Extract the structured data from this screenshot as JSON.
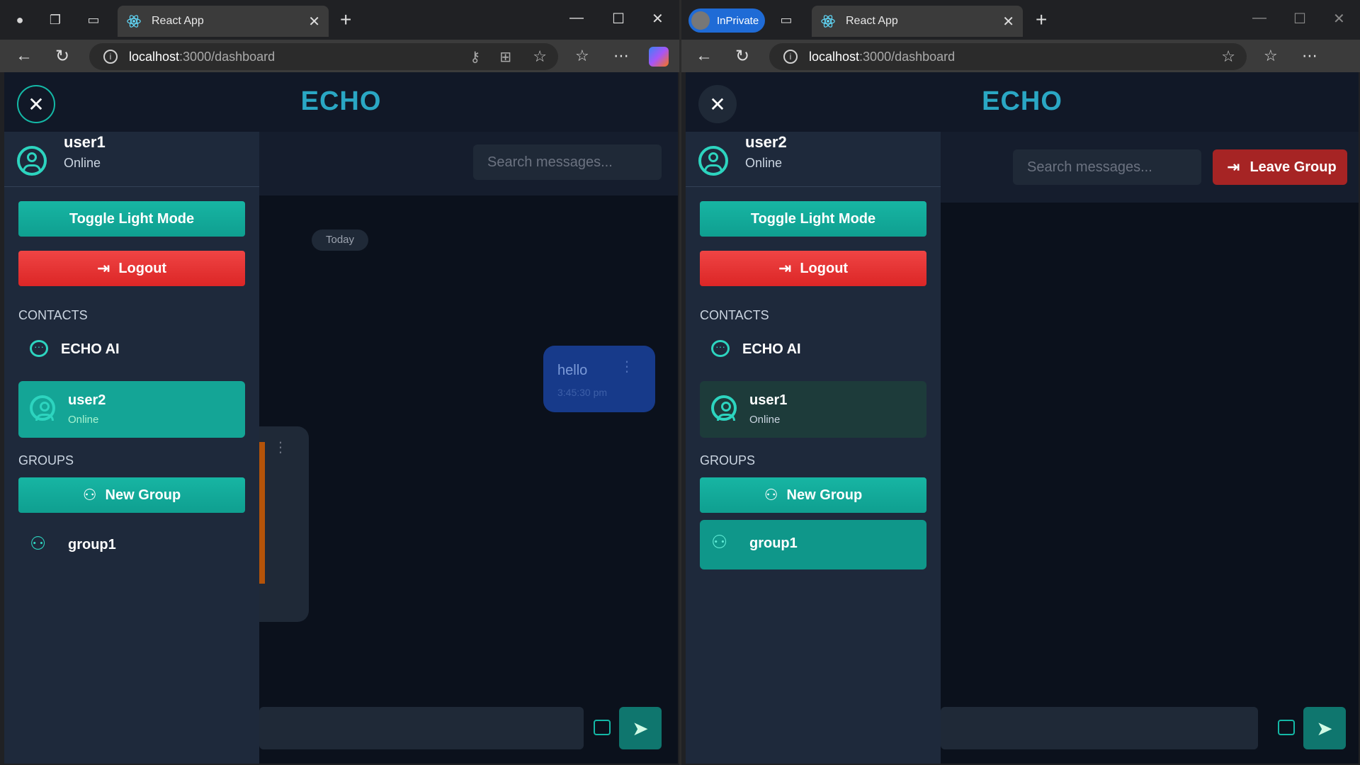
{
  "browser_left": {
    "tab_title": "React App",
    "url_host": "localhost",
    "url_path": ":3000/dashboard"
  },
  "browser_right": {
    "inprivate_label": "InPrivate",
    "tab_title": "React App",
    "url_host": "localhost",
    "url_path": ":3000/dashboard"
  },
  "app": {
    "brand": "ECHO",
    "search_placeholder": "Search messages...",
    "toggle_label": "Toggle Light Mode",
    "logout_label": "Logout",
    "contacts_heading": "CONTACTS",
    "groups_heading": "GROUPS",
    "new_group_label": "New Group",
    "ai_contact": "ECHO AI",
    "status_online": "Online"
  },
  "left_pane": {
    "user_name": "user1",
    "user_status": "Online",
    "contact_name": "user2",
    "contact_status": "Online",
    "group_name": "group1",
    "date_separator": "Today",
    "message_text": "hello",
    "message_time": "3:45:30 pm"
  },
  "right_pane": {
    "user_name": "user2",
    "user_status": "Online",
    "contact_name": "user1",
    "contact_status": "Online",
    "group_name": "group1",
    "leave_group_label": "Leave Group"
  },
  "colors": {
    "accent": "#14b8a6",
    "danger": "#ef4444",
    "brand": "#2aa7c4"
  }
}
